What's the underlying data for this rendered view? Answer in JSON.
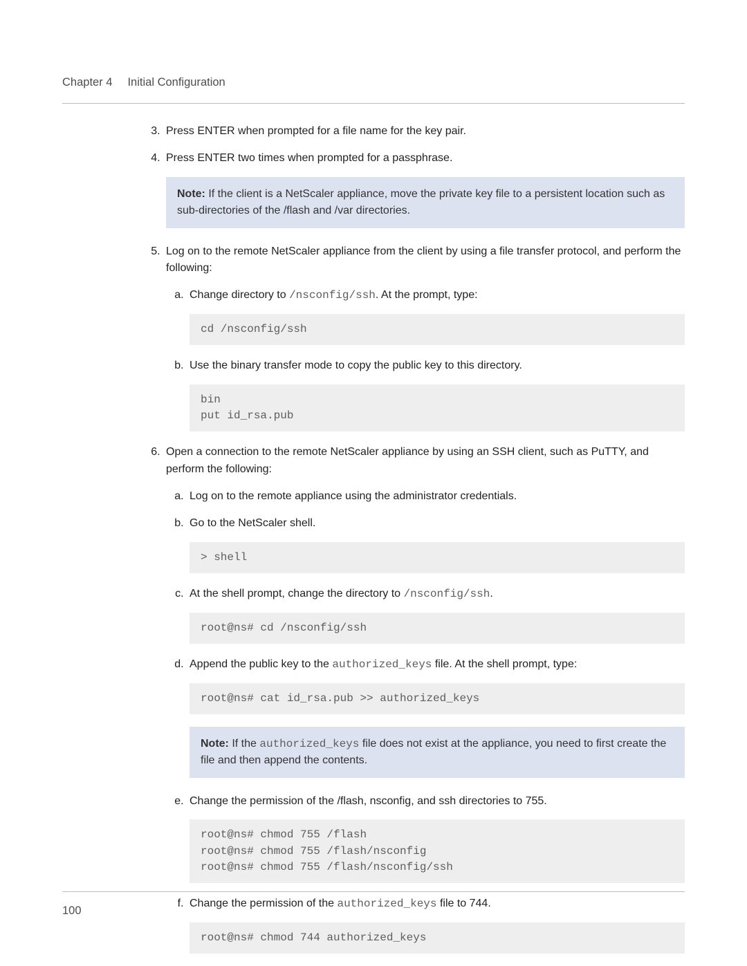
{
  "header": {
    "chapter": "Chapter 4",
    "title": "Initial Configuration"
  },
  "list": {
    "start": 3,
    "item3": "Press ENTER when prompted for a file name for the key pair.",
    "item4": "Press ENTER two times when prompted for a passphrase.",
    "note1_label": "Note:",
    "note1_text": " If the client is a NetScaler appliance, move the private key file to a persistent location such as sub-directories of the /flash and /var directories.",
    "item5": "Log on to the remote NetScaler appliance from the client by using a file transfer protocol, and perform the following:",
    "item5a_pre": "Change directory to ",
    "item5a_code": "/nsconfig/ssh",
    "item5a_post": ". At the prompt, type:",
    "code5a": "cd /nsconfig/ssh",
    "item5b": "Use the binary transfer mode to copy the public key to this directory.",
    "code5b": "bin\nput id_rsa.pub",
    "item6": "Open a connection to the remote NetScaler appliance by using an SSH client, such as PuTTY, and perform the following:",
    "item6a": "Log on to the remote appliance using the administrator credentials.",
    "item6b": "Go to the NetScaler shell.",
    "code6b": "> shell",
    "item6c_pre": "At the shell prompt, change the directory to ",
    "item6c_code": "/nsconfig/ssh",
    "item6c_post": ".",
    "code6c": "root@ns# cd /nsconfig/ssh",
    "item6d_pre": "Append the public key to the ",
    "item6d_code": "authorized_keys",
    "item6d_post": " file. At the shell prompt, type:",
    "code6d": "root@ns# cat id_rsa.pub >> authorized_keys",
    "note2_label": "Note:",
    "note2_pre": " If the ",
    "note2_code": "authorized_keys",
    "note2_post": " file does not exist at the appliance, you need to first create the file and then append the contents.",
    "item6e": "Change the permission of the /flash, nsconfig, and ssh directories to 755.",
    "code6e": "root@ns# chmod 755 /flash\nroot@ns# chmod 755 /flash/nsconfig\nroot@ns# chmod 755 /flash/nsconfig/ssh",
    "item6f_pre": "Change the permission of the ",
    "item6f_code": "authorized_keys",
    "item6f_post": " file to 744.",
    "code6f": "root@ns# chmod 744 authorized_keys"
  },
  "footer": {
    "page_number": "100"
  }
}
